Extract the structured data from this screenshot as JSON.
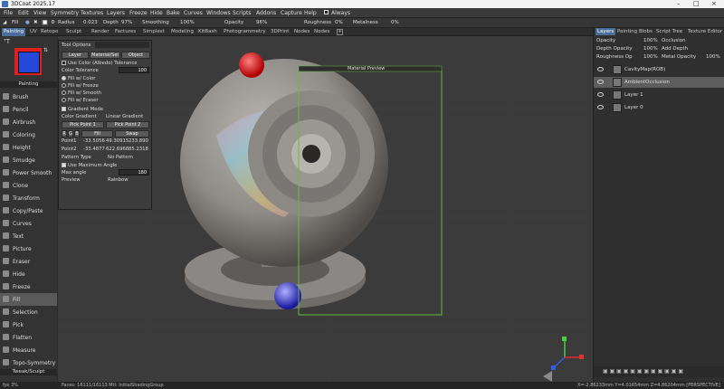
{
  "app": {
    "title": "3DCoat 2025.17"
  },
  "menu": [
    "File",
    "Edit",
    "View",
    "Symmetry",
    "Textures",
    "Layers",
    "Freeze",
    "Hide",
    "Bake",
    "Curves",
    "Windows",
    "Scripts",
    "Addons",
    "Capture",
    "Help"
  ],
  "always_label": "Always",
  "toolbar": {
    "fill_label": "Fill",
    "radius_label": "Radius",
    "radius_value": "0.023",
    "depth_label": "Depth",
    "depth_value": "97%",
    "smoothing_label": "Smoothing",
    "smoothing_value": "100%",
    "opacity_label": "Opacity",
    "opacity_value": "96%",
    "roughness_label": "Roughness",
    "roughness_value": "0%",
    "metalness_label": "Metalness",
    "metalness_value": "0%"
  },
  "rooms": [
    "Painting",
    "UV",
    "Retopo",
    "Sculpt",
    "Render",
    "Factures",
    "Simplest",
    "Modeling",
    "KitBash",
    "Photogrammetry",
    "3DPrint",
    "Nodes",
    "Nodes"
  ],
  "left": {
    "section_painting": "Painting",
    "section_tweak": "Tweak/Sculpt",
    "tools": [
      "Brush",
      "Pencil",
      "Airbrush",
      "Coloring",
      "Height",
      "Smudge",
      "Power Smooth",
      "Clone",
      "Transform",
      "Copy/Paste",
      "Curves",
      "Text",
      "Picture",
      "Eraser",
      "Hide",
      "Freeze",
      "Fill",
      "Selection",
      "Pick",
      "Flatten",
      "Measure",
      "Topo-Symmetry"
    ]
  },
  "tool_options": {
    "title": "Tool Options",
    "tabs": [
      "Layer",
      "Material/Sel",
      "Object"
    ],
    "use_color_tolerance": "Use Color (Albedo) Tolerance",
    "color_tolerance_label": "Color Tolerance",
    "color_tolerance_value": "100",
    "fill_modes": [
      "Fill w/ Color",
      "Fill w/ Freeze",
      "Fill w/ Smooth",
      "Fill w/ Eraser"
    ],
    "gradient_mode": "Gradient Mode",
    "color_gradient": "Color Gradient",
    "linear_gradient": "Linear Gradient",
    "pick_point_1": "Pick Point 1",
    "pick_point_2": "Pick Point 2",
    "fill_btn": "Fill",
    "swap_btn": "Swap",
    "point1_label": "Point1",
    "point1_values": [
      "-33.5056",
      "49.30915",
      "233.890"
    ],
    "point2_label": "Point2",
    "point2_values": [
      "-33.4877",
      "622.6968",
      "85.2318"
    ],
    "pattern_type_label": "Pattern Type",
    "pattern_type_value": "No Pattern",
    "use_max_angle": "Use Maximum Angle",
    "max_angle_label": "Max angle",
    "max_angle_value": "180",
    "preview_label": "Preview",
    "preview_value": "Rainbow"
  },
  "viewport": {
    "material_preview_label": "Material Preview"
  },
  "right": {
    "tabs": [
      "Layers",
      "Painting",
      "Blobs",
      "Script Tree",
      "Texture Editor"
    ],
    "props": [
      {
        "label": "Opacity",
        "value": "100%",
        "mode": "Occlusion"
      },
      {
        "label": "Depth Opacity",
        "value": "100%",
        "mode": "Add Depth"
      },
      {
        "label": "Roughness Op",
        "value": "100%",
        "mode": "Metal Opacity",
        "mode_value": "100%"
      }
    ],
    "layers": [
      {
        "name": "CavityMap(ROB)",
        "selected": false
      },
      {
        "name": "AmbientOcclusion",
        "selected": true
      },
      {
        "name": "Layer 1",
        "selected": false
      },
      {
        "name": "Layer 0",
        "selected": false
      }
    ]
  },
  "status": {
    "left": "fps 3%",
    "faces": "Faces: 16111/16113  Mtl: InitialShadingGroup",
    "coords": "X=-2.86233mm  Y=4.01654mm  Z=4.86204mm  [PERSPECTIVE]"
  },
  "colors": {
    "accent": "#4a6e98",
    "selection_box": "#5fbf3f"
  }
}
